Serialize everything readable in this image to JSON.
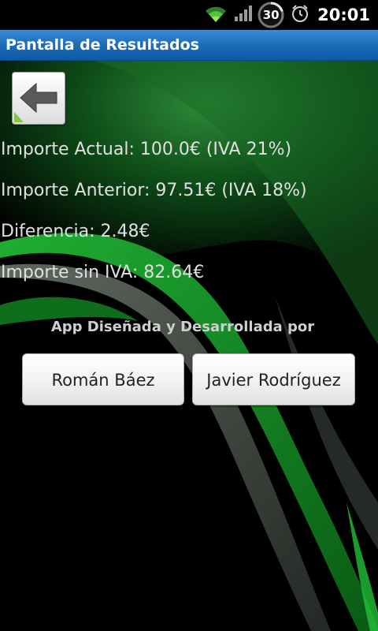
{
  "status_bar": {
    "battery_level": "30",
    "time": "20:01",
    "icons": [
      "wifi-icon",
      "signal-icon",
      "battery-icon",
      "alarm-icon"
    ]
  },
  "title_bar": {
    "title": "Pantalla de Resultados"
  },
  "back_button": {
    "icon": "back-arrow-icon"
  },
  "results": {
    "importe_actual": "Importe Actual: 100.0€ (IVA 21%)",
    "importe_anterior": "Importe Anterior: 97.51€ (IVA 18%)",
    "diferencia": "Diferencia: 2.48€",
    "importe_sin_iva": "Importe sin IVA: 82.64€"
  },
  "credits": {
    "label": "App Diseñada y Desarrollada por",
    "authors": [
      "Román Báez",
      "Javier Rodríguez"
    ]
  },
  "colors": {
    "title_bar": "#1e6fba",
    "background": "#000000",
    "accent_green": "#1a9a2a",
    "text": "#e0e0e0"
  }
}
